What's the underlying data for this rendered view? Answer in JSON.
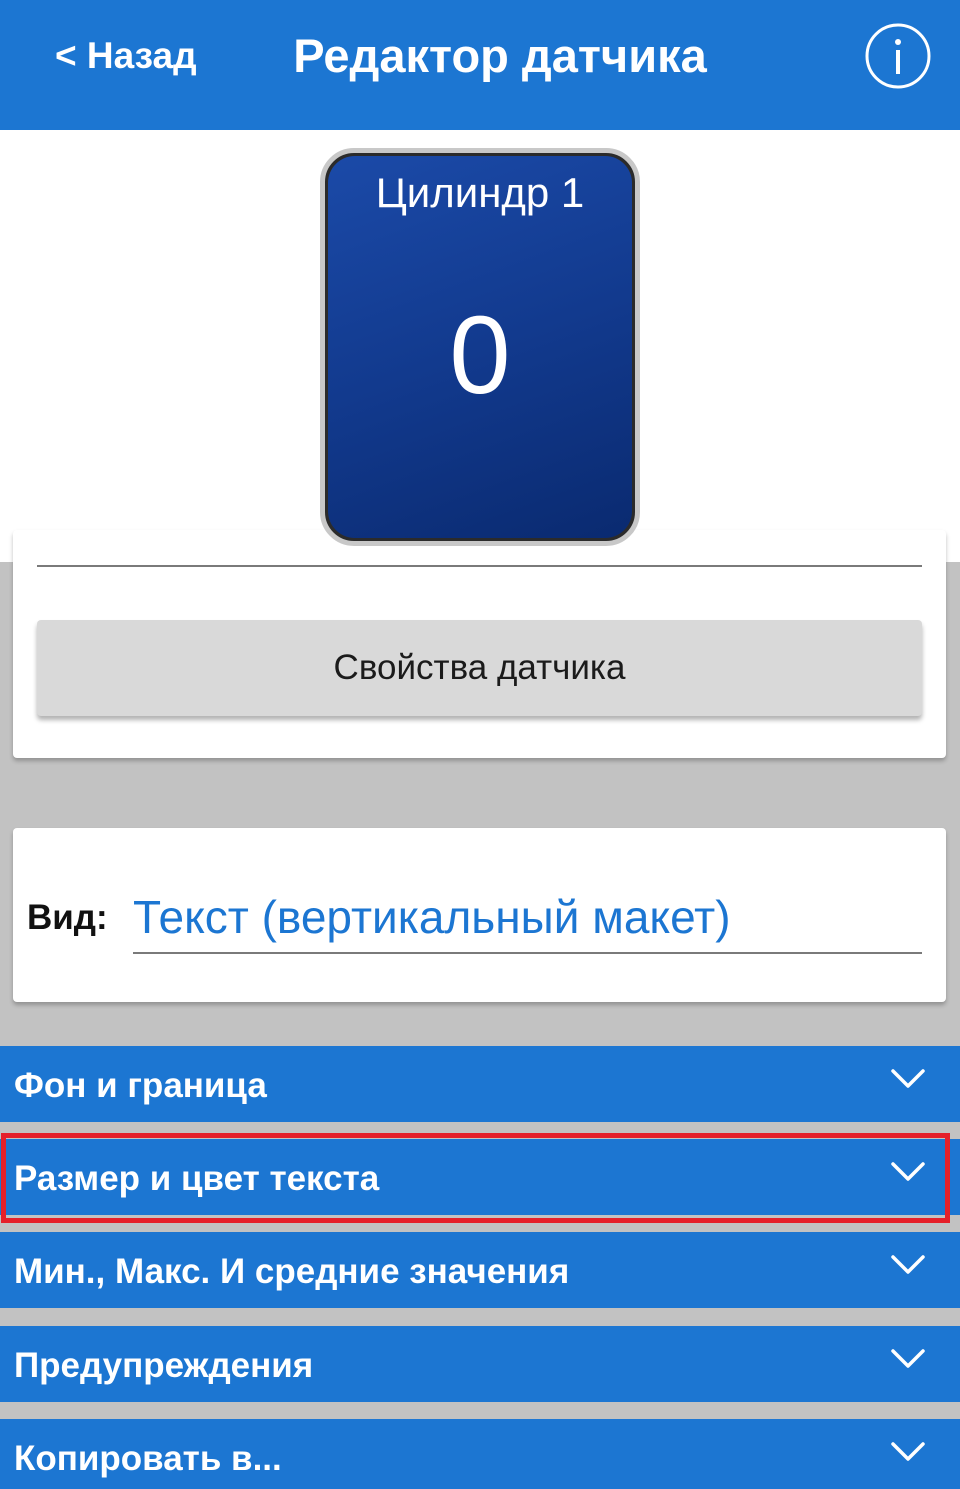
{
  "header": {
    "back_label": "< Назад",
    "title": "Редактор датчика",
    "info_icon": "info-icon"
  },
  "sensor_preview": {
    "name": "Цилиндр 1",
    "value": "0"
  },
  "sensor_properties_button": "Свойства датчика",
  "view": {
    "label": "Вид:",
    "value": "Текст (вертикальный макет)"
  },
  "sections": [
    {
      "label": "Фон и граница"
    },
    {
      "label": "Размер и цвет текста",
      "highlighted": true
    },
    {
      "label": "Мин., Макс. И средние значения"
    },
    {
      "label": "Предупреждения"
    },
    {
      "label": "Копировать в..."
    }
  ],
  "colors": {
    "accent": "#1c76d2",
    "highlight": "#e5202a",
    "tile": "#123a8e",
    "background": "#c2c2c2"
  }
}
